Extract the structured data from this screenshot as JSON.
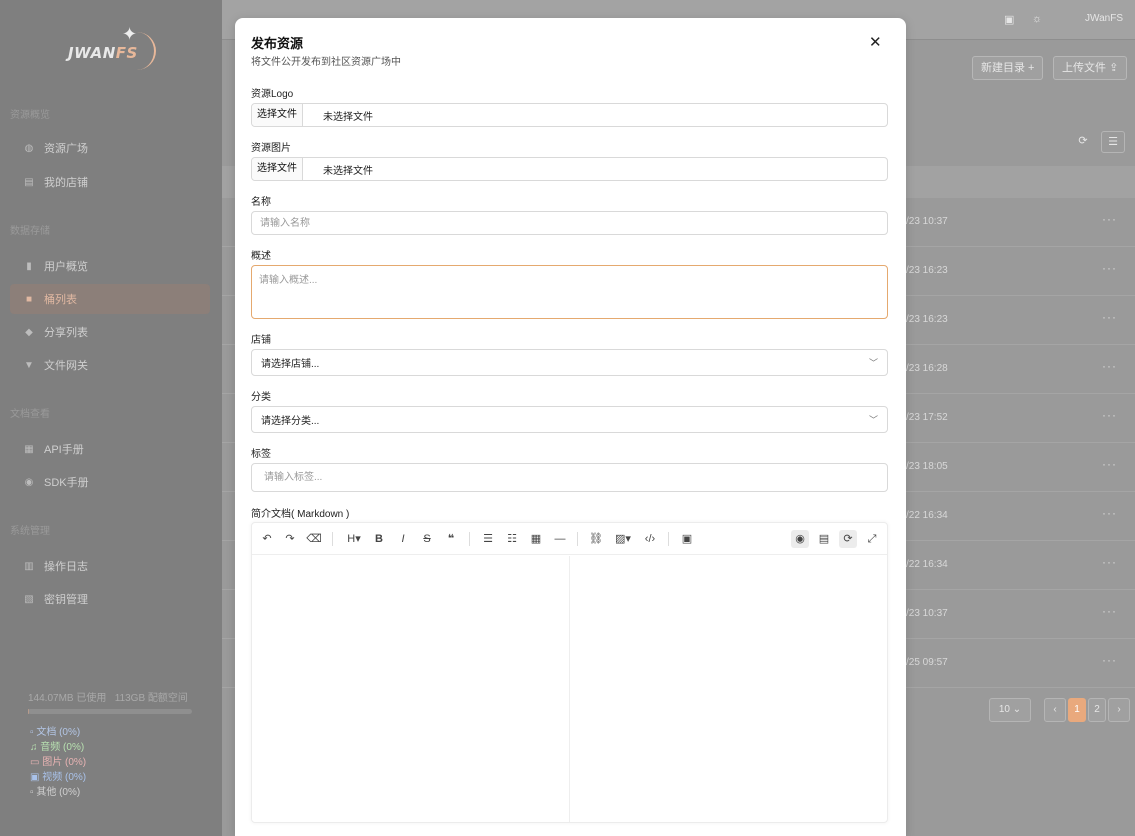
{
  "sidebar": {
    "logo": {
      "text_main": "JWAN",
      "text_accent": "FS"
    },
    "sections": [
      {
        "title": "资源概览",
        "items": [
          {
            "label": "资源广场",
            "icon": "globe-icon"
          },
          {
            "label": "我的店铺",
            "icon": "store-icon"
          }
        ]
      },
      {
        "title": "数据存储",
        "items": [
          {
            "label": "用户概览",
            "icon": "chart-icon"
          },
          {
            "label": "桶列表",
            "icon": "bucket-icon",
            "active": true
          },
          {
            "label": "分享列表",
            "icon": "share-icon"
          },
          {
            "label": "文件网关",
            "icon": "gateway-icon"
          }
        ]
      },
      {
        "title": "文档查看",
        "items": [
          {
            "label": "API手册",
            "icon": "api-icon"
          },
          {
            "label": "SDK手册",
            "icon": "sdk-icon"
          }
        ]
      },
      {
        "title": "系统管理",
        "items": [
          {
            "label": "操作日志",
            "icon": "log-icon"
          },
          {
            "label": "密钥管理",
            "icon": "key-icon"
          }
        ]
      }
    ],
    "storage": {
      "used": "144.07MB 已使用",
      "quota": "113GB 配额空间",
      "used_fraction": 0.0013,
      "categories": [
        {
          "label": "文档 (0%)",
          "color": "#b3c6e6"
        },
        {
          "label": "音频 (0%)",
          "color": "#b7e0b0"
        },
        {
          "label": "图片 (0%)",
          "color": "#e8b3b3"
        },
        {
          "label": "视频 (0%)",
          "color": "#a9c2ea"
        },
        {
          "label": "其他 (0%)",
          "color": "#d0d0d0"
        }
      ]
    }
  },
  "topbar": {
    "user": "JWanFS"
  },
  "toolbar_bg": {
    "new_dir": "新建目录 +",
    "upload": "上传文件"
  },
  "rows": [
    {
      "time": "/23 10:37"
    },
    {
      "time": "/23 16:23"
    },
    {
      "time": "/23 16:23"
    },
    {
      "time": "/23 16:28"
    },
    {
      "time": "/23 17:52"
    },
    {
      "time": "/23 18:05"
    },
    {
      "time": "/22 16:34"
    },
    {
      "time": "/22 16:34"
    },
    {
      "time": "/23 10:37"
    },
    {
      "time": "/25 09:57"
    }
  ],
  "pagination": {
    "page_size": "10",
    "pages": [
      "1",
      "2"
    ],
    "current": "1"
  },
  "modal": {
    "title": "发布资源",
    "subtitle": "将文件公开发布到社区资源广场中",
    "logo": {
      "label": "资源Logo",
      "button": "选择文件",
      "status": "未选择文件"
    },
    "image": {
      "label": "资源图片",
      "button": "选择文件",
      "status": "未选择文件"
    },
    "name": {
      "label": "名称",
      "placeholder": "请输入名称"
    },
    "summary": {
      "label": "概述",
      "placeholder": "请输入概述..."
    },
    "store": {
      "label": "店铺",
      "placeholder": "请选择店铺..."
    },
    "category": {
      "label": "分类",
      "placeholder": "请选择分类..."
    },
    "tags": {
      "label": "标签",
      "placeholder": "请输入标签..."
    },
    "intro": {
      "label": "简介文档( Markdown )"
    }
  },
  "colors": {
    "accent": "#e9a97d",
    "focus_border": "#e5a96f"
  }
}
